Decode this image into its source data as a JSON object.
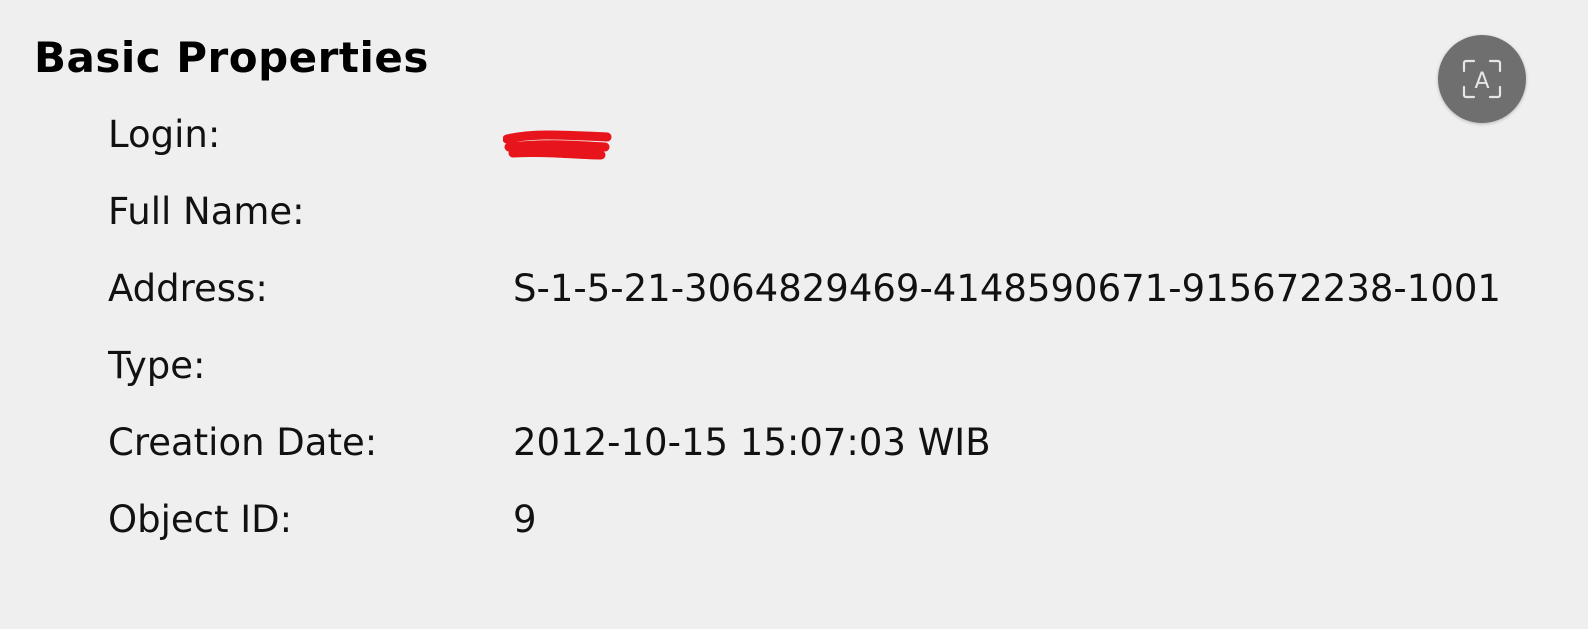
{
  "section": {
    "title": "Basic Properties"
  },
  "properties": [
    {
      "label": "Login:",
      "value": "",
      "redacted": true
    },
    {
      "label": "Full Name:",
      "value": ""
    },
    {
      "label": "Address:",
      "value": "S-1-5-21-3064829469-4148590671-915672238-1001"
    },
    {
      "label": "Type:",
      "value": ""
    },
    {
      "label": "Creation Date:",
      "value": "2012-10-15 15:07:03 WIB"
    },
    {
      "label": "Object ID:",
      "value": "9"
    }
  ],
  "redaction": {
    "color": "#e8141b"
  },
  "fab": {
    "icon": "text-scan-icon",
    "glyph": "A",
    "color": "#6f6f6f"
  }
}
